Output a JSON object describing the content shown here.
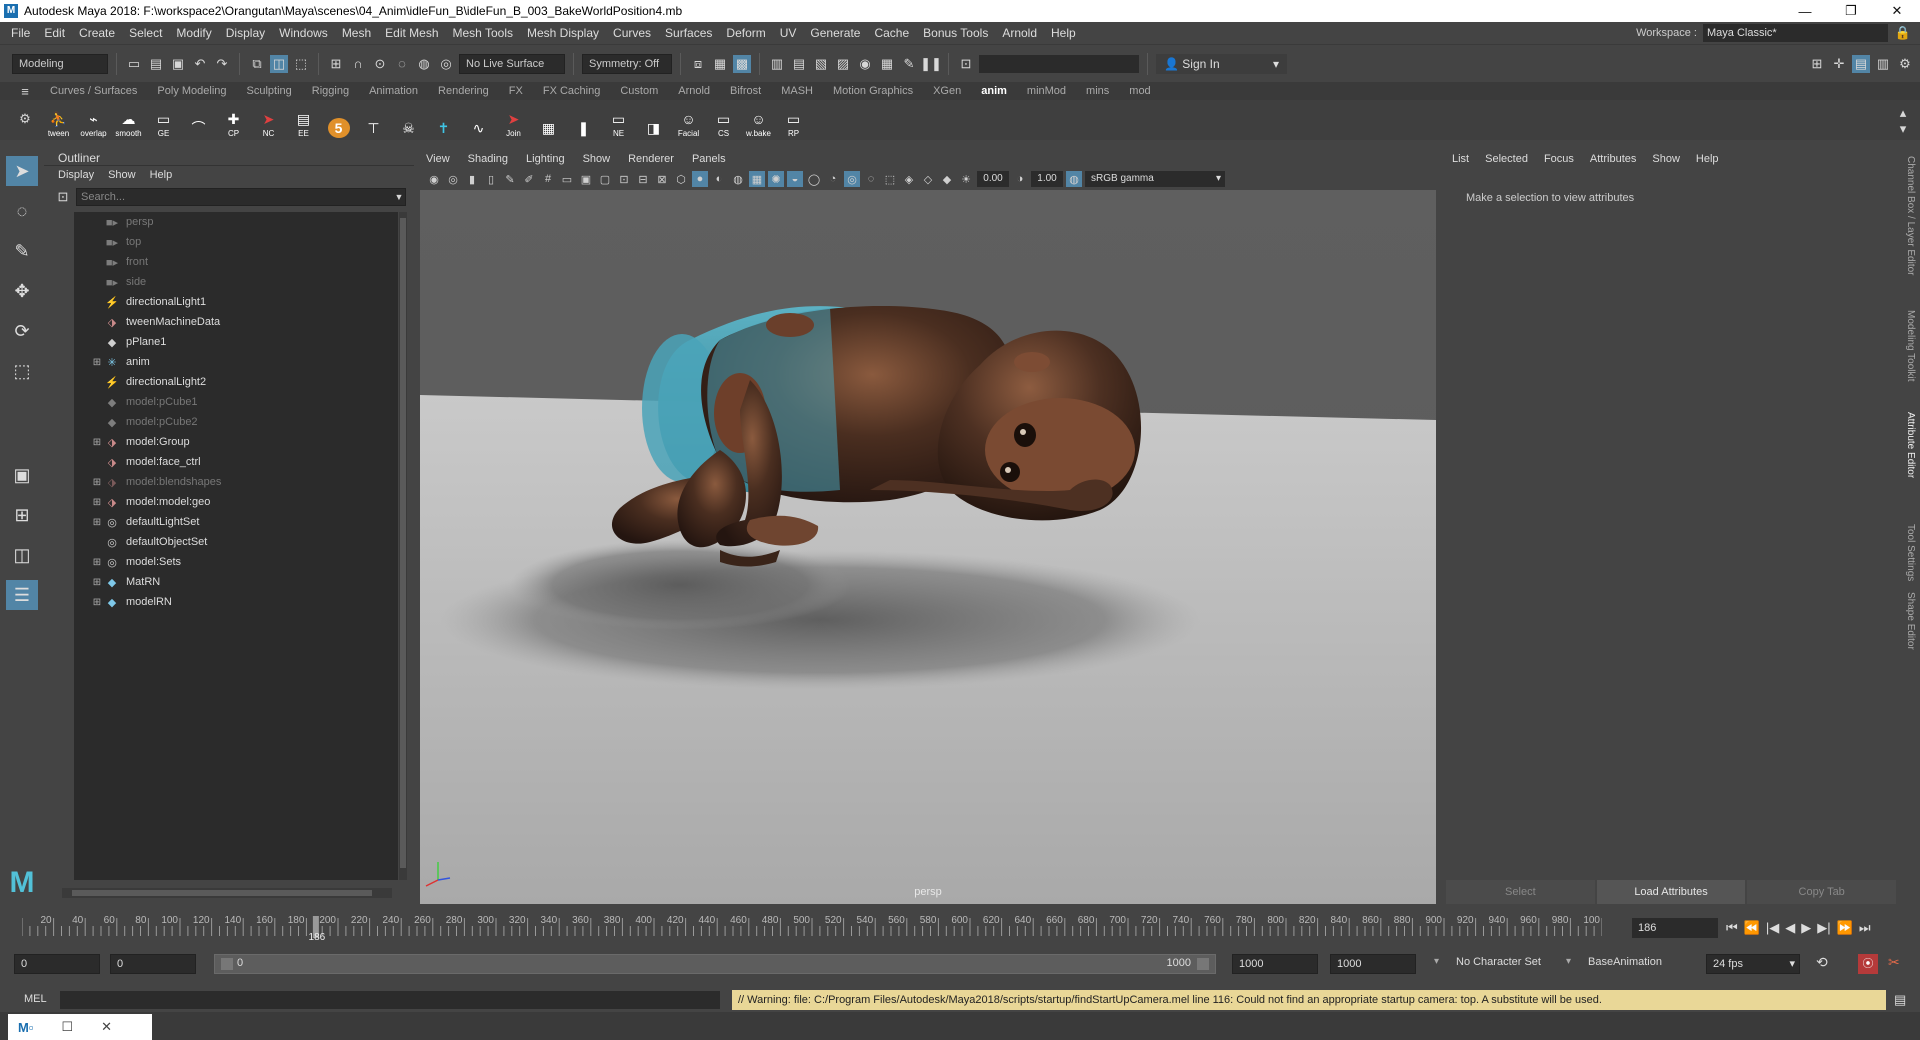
{
  "window": {
    "title": "Autodesk Maya 2018: F:\\workspace2\\Orangutan\\Maya\\scenes\\04_Anim\\idleFun_B\\idleFun_B_003_BakeWorldPosition4.mb",
    "minimize": "—",
    "restore": "❐",
    "close": "✕"
  },
  "menubar": {
    "items": [
      "File",
      "Edit",
      "Create",
      "Select",
      "Modify",
      "Display",
      "Windows",
      "Mesh",
      "Edit Mesh",
      "Mesh Tools",
      "Mesh Display",
      "Curves",
      "Surfaces",
      "Deform",
      "UV",
      "Generate",
      "Cache",
      "Bonus Tools",
      "Arnold",
      "Help"
    ],
    "workspace_label": "Workspace :",
    "workspace_value": "Maya Classic*"
  },
  "statusline": {
    "menuset": "Modeling",
    "live_surface": "No Live Surface",
    "symmetry": "Symmetry: Off",
    "sign_in": "Sign In"
  },
  "shelf": {
    "tabs": [
      "Curves / Surfaces",
      "Poly Modeling",
      "Sculpting",
      "Rigging",
      "Animation",
      "Rendering",
      "FX",
      "FX Caching",
      "Custom",
      "Arnold",
      "Bifrost",
      "MASH",
      "Motion Graphics",
      "XGen",
      "anim",
      "minMod",
      "mins",
      "mod"
    ],
    "active_tab": "anim",
    "buttons": [
      {
        "label": "tween",
        "icon": "tween-icon"
      },
      {
        "label": "overlap",
        "icon": "overlap-icon"
      },
      {
        "label": "smooth",
        "icon": "smooth-icon"
      },
      {
        "label": "GE",
        "icon": "graph-editor-icon"
      },
      {
        "label": "",
        "icon": "arc-icon"
      },
      {
        "label": "CP",
        "icon": "pivot-icon"
      },
      {
        "label": "NC",
        "icon": "cursor-icon"
      },
      {
        "label": "EE",
        "icon": "editor-icon"
      },
      {
        "label": "",
        "icon": "five-icon"
      },
      {
        "label": "",
        "icon": "t-pose-icon"
      },
      {
        "label": "",
        "icon": "skull-icon"
      },
      {
        "label": "",
        "icon": "cross-icon"
      },
      {
        "label": "",
        "icon": "curve-icon"
      },
      {
        "label": "Join",
        "icon": "join-icon"
      },
      {
        "label": "",
        "icon": "grid-icon"
      },
      {
        "label": "",
        "icon": "bars-icon"
      },
      {
        "label": "NE",
        "icon": "node-editor-icon"
      },
      {
        "label": "",
        "icon": "cube-icon"
      },
      {
        "label": "Facial",
        "icon": "facial-icon"
      },
      {
        "label": "CS",
        "icon": "cs-icon"
      },
      {
        "label": "w.bake",
        "icon": "bake-icon"
      },
      {
        "label": "RP",
        "icon": "rp-icon"
      }
    ]
  },
  "outliner": {
    "title": "Outliner",
    "menu": [
      "Display",
      "Show",
      "Help"
    ],
    "search_placeholder": "Search...",
    "items": [
      {
        "name": "persp",
        "icon": "camera-icon",
        "expandable": false,
        "dim": true
      },
      {
        "name": "top",
        "icon": "camera-icon",
        "expandable": false,
        "dim": true
      },
      {
        "name": "front",
        "icon": "camera-icon",
        "expandable": false,
        "dim": true
      },
      {
        "name": "side",
        "icon": "camera-icon",
        "expandable": false,
        "dim": true
      },
      {
        "name": "directionalLight1",
        "icon": "light-icon",
        "expandable": false,
        "dim": false
      },
      {
        "name": "tweenMachineData",
        "icon": "node-icon",
        "expandable": false,
        "dim": false
      },
      {
        "name": "pPlane1",
        "icon": "mesh-icon",
        "expandable": false,
        "dim": false
      },
      {
        "name": "anim",
        "icon": "joint-icon",
        "expandable": true,
        "dim": false
      },
      {
        "name": "directionalLight2",
        "icon": "light-icon",
        "expandable": false,
        "dim": false
      },
      {
        "name": "model:pCube1",
        "icon": "mesh-icon",
        "expandable": false,
        "dim": true
      },
      {
        "name": "model:pCube2",
        "icon": "mesh-icon",
        "expandable": false,
        "dim": true
      },
      {
        "name": "model:Group",
        "icon": "group-icon",
        "expandable": true,
        "dim": false
      },
      {
        "name": "model:face_ctrl",
        "icon": "node-icon",
        "expandable": false,
        "dim": false
      },
      {
        "name": "model:blendshapes",
        "icon": "group-icon",
        "expandable": true,
        "dim": true
      },
      {
        "name": "model:model:geo",
        "icon": "group-icon",
        "expandable": true,
        "dim": false
      },
      {
        "name": "defaultLightSet",
        "icon": "set-icon",
        "expandable": true,
        "dim": false
      },
      {
        "name": "defaultObjectSet",
        "icon": "set-icon",
        "expandable": false,
        "dim": false
      },
      {
        "name": "model:Sets",
        "icon": "set-icon",
        "expandable": true,
        "dim": false
      },
      {
        "name": "MatRN",
        "icon": "reference-icon",
        "expandable": true,
        "dim": false
      },
      {
        "name": "modelRN",
        "icon": "reference-icon",
        "expandable": true,
        "dim": false
      }
    ]
  },
  "viewport": {
    "menu": [
      "View",
      "Shading",
      "Lighting",
      "Show",
      "Renderer",
      "Panels"
    ],
    "exposure": "0.00",
    "gamma": "1.00",
    "color_space": "sRGB gamma",
    "camera_label": "persp"
  },
  "attribute_editor": {
    "menu": [
      "List",
      "Selected",
      "Focus",
      "Attributes",
      "Show",
      "Help"
    ],
    "message": "Make a selection to view attributes",
    "buttons": [
      "Select",
      "Load Attributes",
      "Copy Tab"
    ],
    "side_tabs": [
      "Channel Box / Layer Editor",
      "Modeling Toolkit",
      "Attribute Editor",
      "Tool Settings",
      "Shape Editor"
    ]
  },
  "timeline": {
    "tick_labels": [
      "20",
      "40",
      "60",
      "80",
      "100",
      "120",
      "140",
      "160",
      "180",
      "200",
      "220",
      "240",
      "260",
      "280",
      "300",
      "320",
      "340",
      "360",
      "380",
      "400",
      "420",
      "440",
      "460",
      "480",
      "500",
      "520",
      "540",
      "560",
      "580",
      "600",
      "620",
      "640",
      "660",
      "680",
      "700",
      "720",
      "740",
      "760",
      "780",
      "800",
      "820",
      "840",
      "860",
      "880",
      "900",
      "920",
      "940",
      "960",
      "980",
      "100"
    ],
    "start": 0,
    "end": 1000,
    "current_frame": 186,
    "current_frame_text": "186"
  },
  "range": {
    "start_time": "0",
    "playback_start": "0",
    "slider_start": "0",
    "slider_end": "1000",
    "playback_end": "1000",
    "end_time": "1000",
    "character_set": "No Character Set",
    "anim_layer": "BaseAnimation",
    "fps": "24 fps"
  },
  "cmdline": {
    "lang": "MEL",
    "warning": "// Warning: file: C:/Program Files/Autodesk/Maya2018/scripts/startup/findStartUpCamera.mel line 116: Could not find an appropriate startup camera: top.  A substitute will be used."
  },
  "colors": {
    "panel_bg": "#444444",
    "field_bg": "#2b2b2b",
    "accent": "#5285a6",
    "warning_bg": "#e9d797",
    "orangutan_body": "#3b2519",
    "orangutan_light": "#7a4a32",
    "cylinder": "#4aa3b8"
  }
}
